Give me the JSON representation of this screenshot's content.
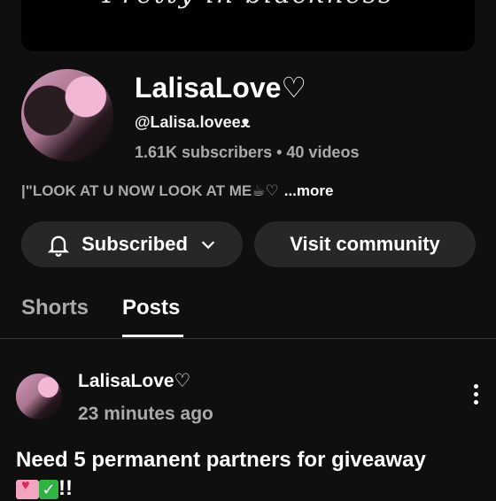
{
  "banner": {
    "text": "Pretty in blackness"
  },
  "channel": {
    "name": "LalisaLove♡",
    "handle": "@Lalisa.loveeᴥ",
    "subscribers": "1.61K subscribers",
    "videos": "40 videos",
    "stats_separator": "•",
    "description": "|\"LOOK AT U NOW LOOK AT ME☕♡",
    "more_label": "...more"
  },
  "actions": {
    "subscribed_label": "Subscribed",
    "community_label": "Visit community"
  },
  "tabs": [
    {
      "label": "Shorts",
      "selected": false
    },
    {
      "label": "Posts",
      "selected": true
    }
  ],
  "post": {
    "author": "LalisaLove♡",
    "time": "23 minutes ago",
    "text": "Need 5 permanent partners for giveaway",
    "suffix": "!!"
  },
  "icons": {
    "subscribe": "bell-icon",
    "dropdown": "chevron-down-icon",
    "post_menu": "more-vertical-icon"
  },
  "colors": {
    "background": "#0f0f0f",
    "button": "#272727",
    "secondary_text": "#aaaaaa",
    "primary_text": "#ffffff"
  }
}
